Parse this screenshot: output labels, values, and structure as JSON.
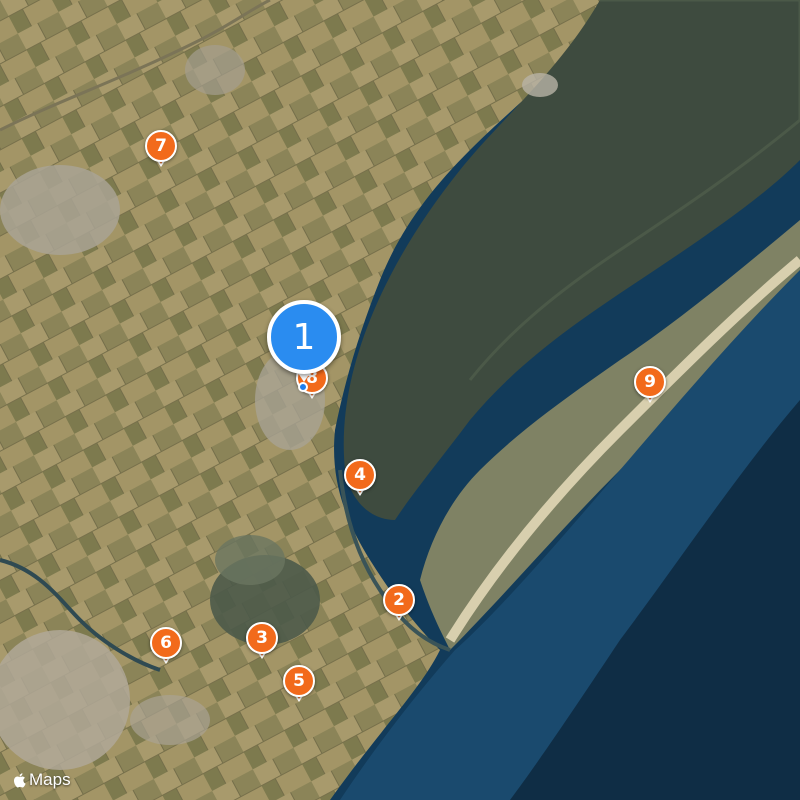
{
  "map": {
    "style": "satellite",
    "colors": {
      "land": "#9b8f62",
      "lagoon": "#3c4a3e",
      "sea": "#123b5a",
      "beach": "#d8cfae",
      "town": "#a8a294",
      "marker": "#f26a1b",
      "selected_marker": "#2a8cf0"
    }
  },
  "markers": [
    {
      "label": "1",
      "kind": "selected",
      "color": "#2a8cf0"
    },
    {
      "label": "2"
    },
    {
      "label": "3"
    },
    {
      "label": "4"
    },
    {
      "label": "5"
    },
    {
      "label": "6"
    },
    {
      "label": "7"
    },
    {
      "label": "8"
    },
    {
      "label": "9"
    }
  ],
  "current_location": {
    "icon": "location-dot-icon"
  },
  "attribution": {
    "icon": "apple-logo-icon",
    "text": "Maps"
  }
}
